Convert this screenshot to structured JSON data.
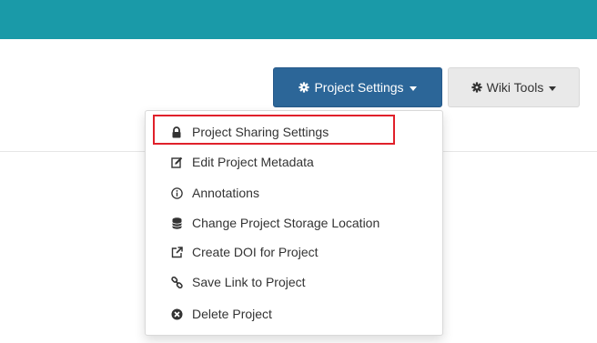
{
  "header": {
    "bar_color": "#1a9aa8"
  },
  "toolbar": {
    "project_settings_label": "Project Settings",
    "project_settings_icon": "gear-icon",
    "wiki_tools_label": "Wiki Tools",
    "wiki_tools_icon": "gear-icon"
  },
  "menu": {
    "items": [
      {
        "label": "Project Sharing Settings",
        "icon": "lock-icon"
      },
      {
        "label": "Edit Project Metadata",
        "icon": "edit-icon"
      },
      {
        "label": "Annotations",
        "icon": "info-icon"
      },
      {
        "label": "Change Project Storage Location",
        "icon": "database-icon"
      },
      {
        "label": "Create DOI for Project",
        "icon": "external-link-icon"
      },
      {
        "label": "Save Link to Project",
        "icon": "link-icon"
      },
      {
        "label": "Delete Project",
        "icon": "remove-icon"
      }
    ],
    "highlighted_item": "Project Sharing Settings"
  },
  "colors": {
    "primary_button": "#2c6698",
    "default_button": "#e9e9e9",
    "highlight": "#e0202a"
  }
}
